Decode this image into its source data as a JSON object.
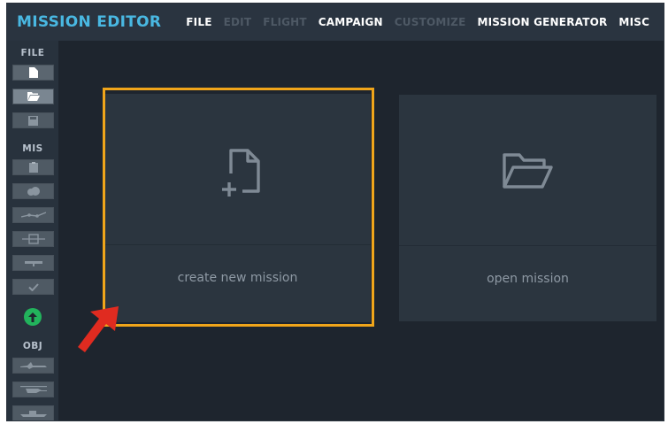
{
  "app": {
    "title": "MISSION EDITOR"
  },
  "menu": [
    {
      "label": "FILE",
      "enabled": true
    },
    {
      "label": "EDIT",
      "enabled": false
    },
    {
      "label": "FLIGHT",
      "enabled": false
    },
    {
      "label": "CAMPAIGN",
      "enabled": true
    },
    {
      "label": "CUSTOMIZE",
      "enabled": false
    },
    {
      "label": "MISSION GENERATOR",
      "enabled": true
    },
    {
      "label": "MISC",
      "enabled": true
    }
  ],
  "sidebar": {
    "sections": [
      {
        "label": "FILE",
        "buttons": [
          "new-file-icon",
          "open-folder-icon",
          "save-icon"
        ]
      },
      {
        "label": "MIS",
        "buttons": [
          "clipboard-icon",
          "weather-icon",
          "route-icon",
          "trigger-zone-icon",
          "line-icon",
          "check-icon"
        ]
      },
      {
        "label": "OBJ",
        "buttons": [
          "aircraft-icon",
          "helicopter-icon",
          "ship-icon"
        ]
      }
    ],
    "upload_icon": "arrow-up-circle-icon"
  },
  "cards": {
    "create": {
      "label": "create new mission",
      "icon": "new-file-plus-icon"
    },
    "open": {
      "label": "open mission",
      "icon": "open-folder-icon"
    }
  },
  "colors": {
    "accent": "#49b8e2",
    "highlight": "#f0a51a",
    "arrow": "#e02b20",
    "background": "#1e252e",
    "card": "#2b353f"
  }
}
